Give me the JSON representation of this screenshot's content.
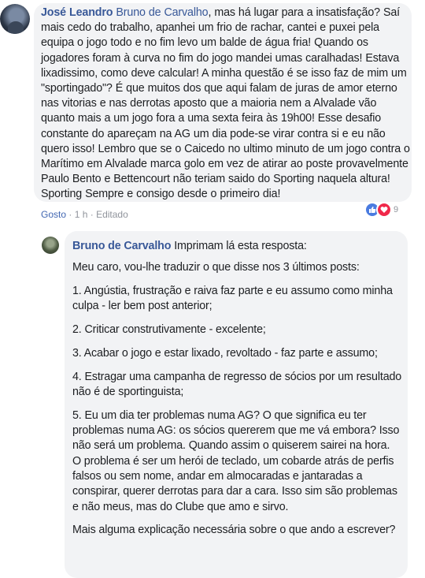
{
  "comment": {
    "author": "José Leandro",
    "mention": "Bruno de Carvalho",
    "text": ", mas há lugar para a insatisfação? Saí mais cedo do trabalho, apanhei um frio de rachar, cantei e puxei pela equipa o jogo todo e no fim levo um balde de água fria! Quando os jogadores foram à curva no fim do jogo mandei umas caralhadas! Estava lixadissimo, como deve calcular! A minha questão é se isso faz de mim um \"sportingado\"? É que muitos dos que aqui falam de juras de amor eterno nas vitorias e nas derrotas aposto que a maioria nem a Alvalade vão quanto mais a um jogo fora a uma sexta feira às 19h00! Esse desafio constante do apareçam na AG um dia pode-se virar contra si e eu não quero isso! Lembro que se o Caicedo no ultimo minuto de um jogo contra o Marítimo em Alvalade marca golo em vez de atirar ao poste provavelmente Paulo Bento e Bettencourt não teriam saido do Sporting naquela altura! Sporting Sempre e consigo desde o primeiro dia!",
    "like_label": "Gosto",
    "time": "1 h",
    "edited": "Editado",
    "reaction_count": "9",
    "icons": [
      "like-reaction-icon",
      "love-reaction-icon"
    ]
  },
  "reply": {
    "author": "Bruno de Carvalho",
    "intro": "Imprimam lá esta resposta:",
    "paragraphs": [
      "Meu caro, vou-lhe traduzir o que disse nos 3 últimos posts:",
      "1. Angústia, frustração e raiva faz parte e eu assumo como minha culpa - ler bem post anterior;",
      "2. Criticar construtivamente - excelente;",
      "3. Acabar o jogo e estar lixado, revoltado - faz parte e assumo;",
      "4. Estragar uma campanha de regresso de sócios por um resultado não é de sportinguista;",
      "5. Eu um dia ter problemas numa AG? O que significa eu ter problemas numa AG: os sócios quererem que me vá embora? Isso não será um problema. Quando assim o quiserem sairei na hora.",
      "O problema é ser um herói de teclado, um cobarde atrás de perfis falsos ou sem nome, andar em almocaradas e jantaradas a conspirar, querer derrotas para dar a cara. Isso sim são problemas e não meus, mas do Clube que amo e sirvo.",
      "Mais alguma explicação necessária sobre o que ando a escrever?"
    ]
  }
}
